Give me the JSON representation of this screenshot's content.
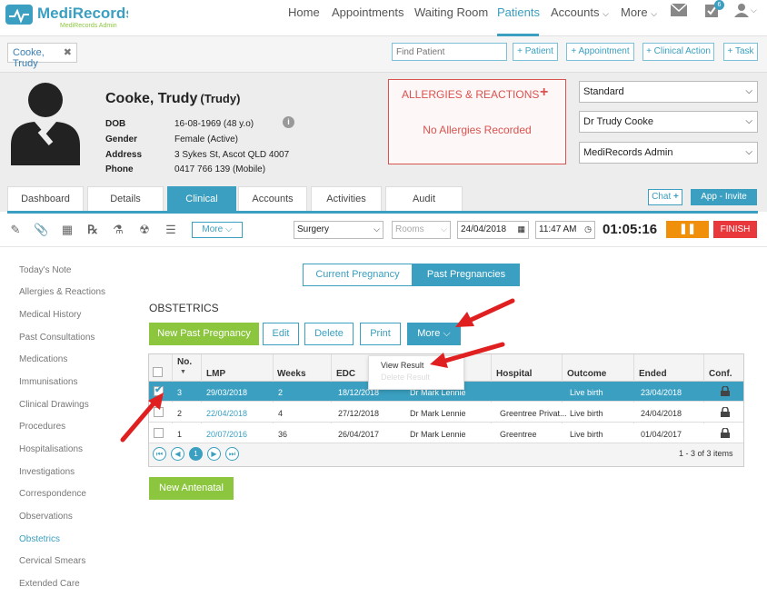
{
  "brand": {
    "name": "MediRecords",
    "tagline": "MediRecords Admin"
  },
  "nav": {
    "home": "Home",
    "appointments": "Appointments",
    "waiting_room": "Waiting Room",
    "patients": "Patients",
    "accounts": "Accounts",
    "more": "More",
    "task_badge": "6"
  },
  "bar2": {
    "patient_tab": "Cooke, Trudy",
    "find_placeholder": "Find Patient",
    "add_patient": "+ Patient",
    "add_appointment": "+ Appointment",
    "add_clinical_action": "+ Clinical Action",
    "add_task": "+ Task"
  },
  "patient": {
    "name": "Cooke, Trudy",
    "nickname": "(Trudy)",
    "labels": {
      "dob": "DOB",
      "gender": "Gender",
      "address": "Address",
      "phone": "Phone"
    },
    "dob": "16-08-1969 (48 y.o)",
    "gender": "Female (Active)",
    "address": "3 Sykes St, Ascot QLD 4007",
    "phone": "0417 766 139 (Mobile)"
  },
  "allergies": {
    "title": "ALLERGIES & REACTIONS",
    "plus": "+",
    "none": "No Allergies Recorded"
  },
  "selects": {
    "template": "Standard",
    "doctor": "Dr Trudy Cooke",
    "admin": "MediRecords Admin"
  },
  "tabs": [
    "Dashboard",
    "Details",
    "Clinical",
    "Accounts",
    "Activities",
    "Audit"
  ],
  "tab_actions": {
    "chat": "Chat",
    "app_invite": "App - Invite"
  },
  "toolbar": {
    "more": "More",
    "location": "Surgery",
    "rooms": "Rooms",
    "date": "24/04/2018",
    "time": "11:47 AM",
    "timer": "01:05:16",
    "finish": "FINISH"
  },
  "sidebar": [
    "Today's Note",
    "Allergies & Reactions",
    "Medical History",
    "Past Consultations",
    "Medications",
    "Immunisations",
    "Clinical Drawings",
    "Procedures",
    "Hospitalisations",
    "Investigations",
    "Correspondence",
    "Observations",
    "Obstetrics",
    "Cervical Smears",
    "Extended Care"
  ],
  "pregnancy": {
    "current": "Current Pregnancy",
    "past": "Past Pregnancies"
  },
  "obstetrics": {
    "title": "OBSTETRICS",
    "new_past": "New Past Pregnancy",
    "edit": "Edit",
    "delete": "Delete",
    "print": "Print",
    "more": "More",
    "new_antenatal": "New Antenatal"
  },
  "table": {
    "headers": {
      "no": "No.",
      "lmp": "LMP",
      "weeks": "Weeks",
      "edc": "EDC",
      "hospital": "Hospital",
      "outcome": "Outcome",
      "ended": "Ended",
      "conf": "Conf."
    },
    "rows": [
      {
        "no": "3",
        "lmp": "29/03/2018",
        "weeks": "2",
        "edc": "18/12/2018",
        "doctor": "Dr Mark Lennie",
        "hospital": "",
        "outcome": "Live birth",
        "ended": "23/04/2018",
        "selected": true
      },
      {
        "no": "2",
        "lmp": "22/04/2018",
        "weeks": "4",
        "edc": "27/12/2018",
        "doctor": "Dr Mark Lennie",
        "hospital": "Greentree Privat...",
        "outcome": "Live birth",
        "ended": "24/04/2018",
        "selected": false
      },
      {
        "no": "1",
        "lmp": "20/07/2016",
        "weeks": "36",
        "edc": "26/04/2017",
        "doctor": "Dr Mark Lennie",
        "hospital": "Greentree",
        "outcome": "Live birth",
        "ended": "01/04/2017",
        "selected": false
      }
    ],
    "pager": {
      "current_page": "1",
      "items": "1 - 3 of 3 items"
    }
  },
  "dropdown": {
    "view_result": "View Result",
    "delete_result": "Delete Result"
  },
  "colors": {
    "accent": "#3a9fc0",
    "green": "#8cc63f",
    "danger": "#d9534f",
    "pause": "#f0900a",
    "finish": "#e8383b",
    "arrow": "#e02020"
  },
  "icons": [
    "notes-icon",
    "attach-icon",
    "calc-icon",
    "prescription-icon",
    "lab-icon",
    "radiation-icon",
    "stack-icon",
    "mail-icon",
    "tasks-icon",
    "user-icon",
    "calendar-icon",
    "clock-icon",
    "lock-icon"
  ]
}
